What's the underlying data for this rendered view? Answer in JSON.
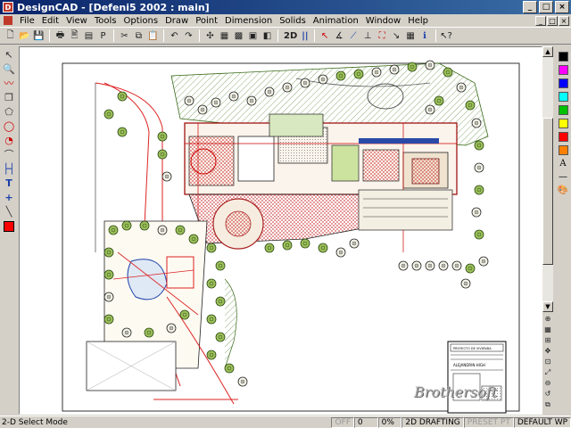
{
  "window": {
    "title": "DesignCAD - [Defeni5 2002 : main]",
    "minimize": "_",
    "maximize": "□",
    "close": "×"
  },
  "menu": {
    "items": [
      "File",
      "Edit",
      "View",
      "Tools",
      "Options",
      "Draw",
      "Point",
      "Dimension",
      "Solids",
      "Animation",
      "Window",
      "Help"
    ]
  },
  "toolbar": {
    "btn_2d": "2D",
    "btn_pause": "||"
  },
  "left_tools": [
    "select-arrow",
    "zoom",
    "line",
    "box",
    "polygon",
    "circle",
    "arc",
    "dimension",
    "text",
    "point",
    "line-tool",
    "color"
  ],
  "palette": {
    "colors": [
      "#000000",
      "#ff00ff",
      "#0000ff",
      "#00ffff",
      "#00c000",
      "#ffff00",
      "#ff0000",
      "#ff8000"
    ],
    "text_tool": "A"
  },
  "status": {
    "mode": "2-D Select Mode",
    "off": "OFF",
    "value": "0",
    "percent": "0%",
    "drafting": "2D DRAFTING",
    "preset": "PRESET PT",
    "wp": "DEFAULT WP"
  },
  "drawing": {
    "title_block_name": "ALEJANDRIN HIGH",
    "title_block_header": "PROYECTO DE VIVIENDA"
  },
  "watermark": "Brothersoft"
}
